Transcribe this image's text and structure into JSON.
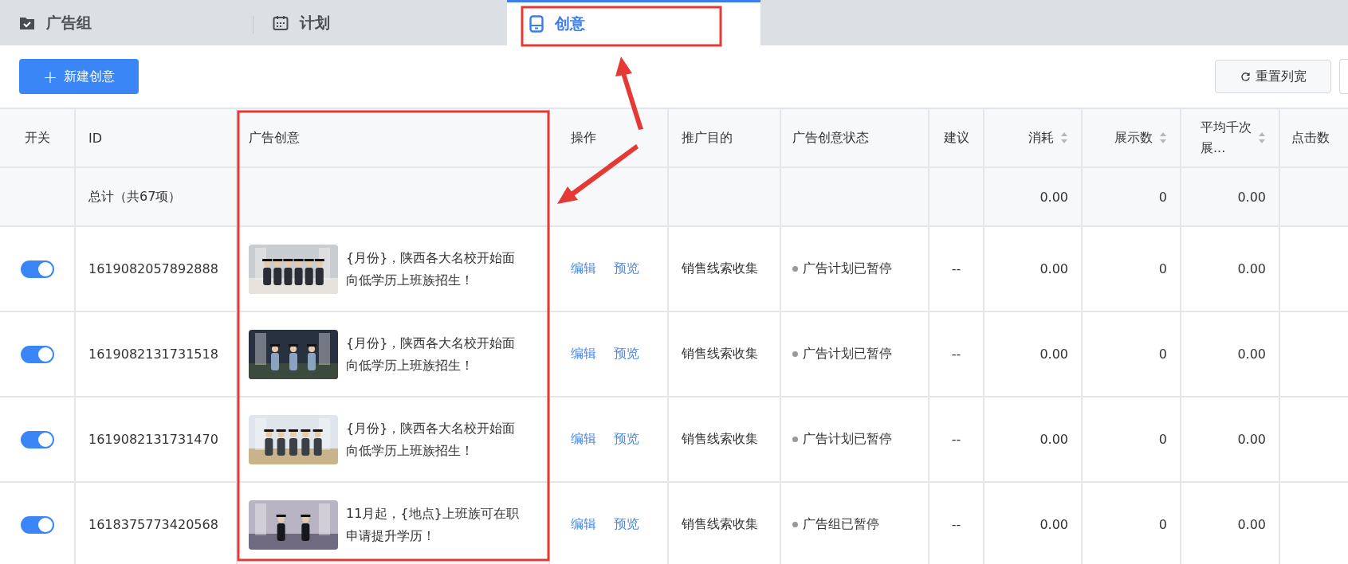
{
  "tabs": [
    {
      "label": "广告组",
      "selected": false
    },
    {
      "label": "计划",
      "selected": false
    },
    {
      "label": "创意",
      "selected": true
    }
  ],
  "toolbar": {
    "new_button": {
      "icon": "+",
      "label": "新建创意"
    },
    "reset_button": "重置列宽"
  },
  "table": {
    "columns": [
      {
        "label": "开关",
        "sortable": false
      },
      {
        "label": "ID",
        "sortable": false
      },
      {
        "label": "广告创意",
        "sortable": false
      },
      {
        "label": "操作",
        "sortable": false
      },
      {
        "label": "推广目的",
        "sortable": false
      },
      {
        "label": "广告创意状态",
        "sortable": false
      },
      {
        "label": "建议",
        "sortable": false
      },
      {
        "label": "消耗",
        "sortable": true
      },
      {
        "label": "展示数",
        "sortable": true
      },
      {
        "label": "平均千次展...",
        "sortable": true
      },
      {
        "label": "点击数",
        "sortable": false
      }
    ],
    "total": {
      "label": "总计（共67项）",
      "cost": "0.00",
      "impressions": "0",
      "cpm": "0.00"
    },
    "rows": [
      {
        "on": true,
        "id": "1619082057892888",
        "creative": "{月份}，陕西各大名校开始面向低学历上班族招生！",
        "actions": [
          "编辑",
          "预览"
        ],
        "purpose": "销售线索收集",
        "status": "广告计划已暂停",
        "suggestion": "--",
        "cost": "0.00",
        "impressions": "0",
        "cpm": "0.00"
      },
      {
        "on": true,
        "id": "1619082131731518",
        "creative": "{月份}，陕西各大名校开始面向低学历上班族招生！",
        "actions": [
          "编辑",
          "预览"
        ],
        "purpose": "销售线索收集",
        "status": "广告计划已暂停",
        "suggestion": "--",
        "cost": "0.00",
        "impressions": "0",
        "cpm": "0.00"
      },
      {
        "on": true,
        "id": "1619082131731470",
        "creative": "{月份}，陕西各大名校开始面向低学历上班族招生！",
        "actions": [
          "编辑",
          "预览"
        ],
        "purpose": "销售线索收集",
        "status": "广告计划已暂停",
        "suggestion": "--",
        "cost": "0.00",
        "impressions": "0",
        "cpm": "0.00"
      },
      {
        "on": true,
        "id": "1618375773420568",
        "creative": "11月起，{地点}上班族可在职申请提升学历！",
        "actions": [
          "编辑",
          "预览"
        ],
        "purpose": "销售线索收集",
        "status": "广告组已暂停",
        "suggestion": "--",
        "cost": "0.00",
        "impressions": "0",
        "cpm": "0.00"
      }
    ]
  }
}
